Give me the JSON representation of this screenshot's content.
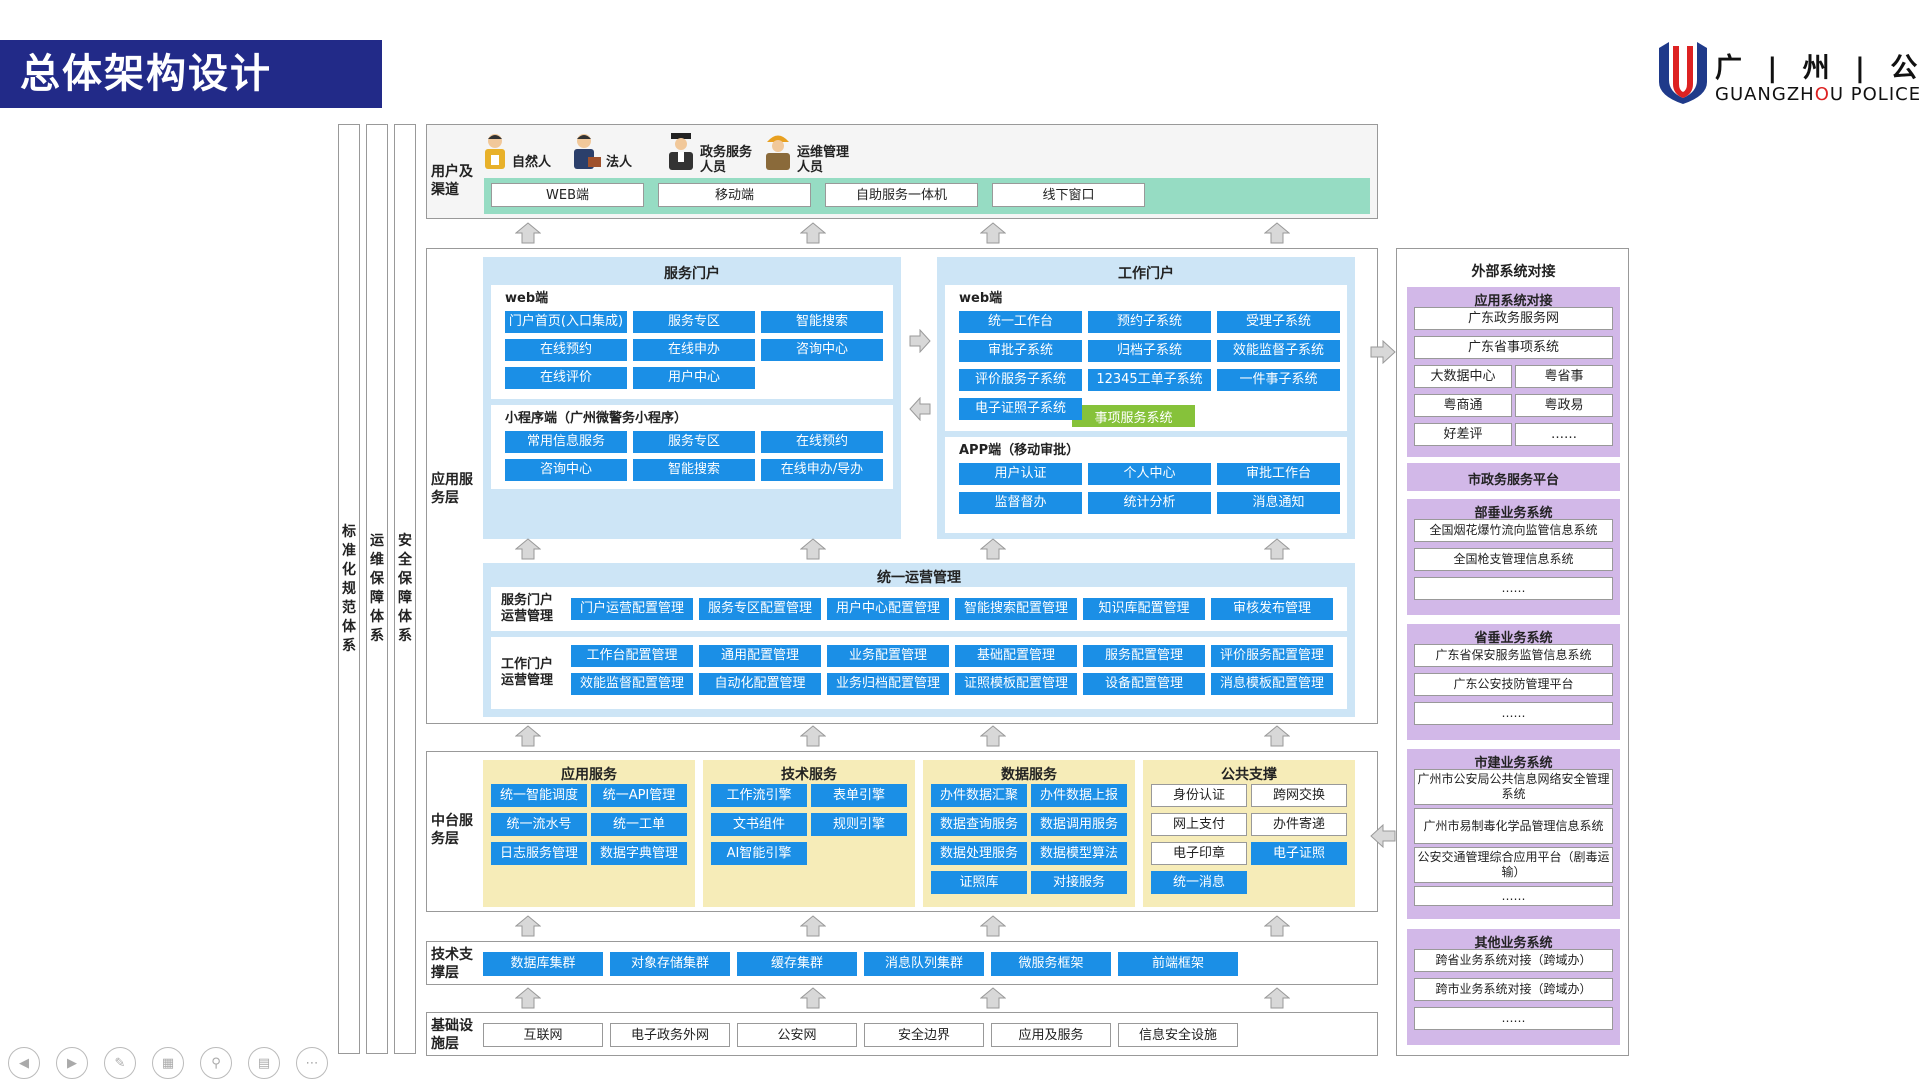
{
  "page": {
    "title": "总体架构设计"
  },
  "logo": {
    "cn": "广 | 州 | 公 | 安",
    "en_pre": "GUANGZH",
    "en_red": "O",
    "en_post": "U POLICE"
  },
  "side_columns": [
    "标准化规范体系",
    "运维保障体系",
    "安全保障体系"
  ],
  "user_layer": {
    "label": "用户及渠道",
    "users": [
      "自然人",
      "法人",
      "政务服务人员",
      "运维管理人员"
    ],
    "channels": [
      "WEB端",
      "移动端",
      "自助服务一体机",
      "线下窗口"
    ]
  },
  "app_layer": {
    "label": "应用服务层",
    "service_portal": {
      "title": "服务门户",
      "web_title": "web端",
      "web_items": [
        "门户首页(入口集成)",
        "服务专区",
        "智能搜索",
        "在线预约",
        "在线申办",
        "咨询中心",
        "在线评价",
        "用户中心"
      ],
      "mini_title": "小程序端（广州微警务小程序）",
      "mini_items": [
        "常用信息服务",
        "服务专区",
        "在线预约",
        "咨询中心",
        "智能搜索",
        "在线申办/导办"
      ]
    },
    "work_portal": {
      "title": "工作门户",
      "web_title": "web端",
      "web_items": [
        "统一工作台",
        "预约子系统",
        "受理子系统",
        "审批子系统",
        "归档子系统",
        "效能监督子系统",
        "评价服务子系统",
        "12345工单子系统",
        "一件事子系统",
        "电子证照子系统"
      ],
      "web_highlight": "事项服务系统",
      "app_title": "APP端（移动审批）",
      "app_items": [
        "用户认证",
        "个人中心",
        "审批工作台",
        "监督督办",
        "统计分析",
        "消息通知"
      ]
    },
    "ops": {
      "title": "统一运营管理",
      "row1_label": "服务门户运营管理",
      "row1": [
        "门户运营配置管理",
        "服务专区配置管理",
        "用户中心配置管理",
        "智能搜索配置管理",
        "知识库配置管理",
        "审核发布管理"
      ],
      "row2_label": "工作门户运营管理",
      "row2": [
        "工作台配置管理",
        "通用配置管理",
        "业务配置管理",
        "基础配置管理",
        "服务配置管理",
        "评价服务配置管理",
        "效能监督配置管理",
        "自动化配置管理",
        "业务归档配置管理",
        "证照模板配置管理",
        "设备配置管理",
        "消息模板配置管理"
      ]
    }
  },
  "middle_layer": {
    "label": "中台服务层",
    "groups": [
      {
        "title": "应用服务",
        "items": [
          "统一智能调度",
          "统一API管理",
          "统一流水号",
          "统一工单",
          "日志服务管理",
          "数据字典管理"
        ]
      },
      {
        "title": "技术服务",
        "items": [
          "工作流引擎",
          "表单引擎",
          "文书组件",
          "规则引擎",
          "AI智能引擎"
        ]
      },
      {
        "title": "数据服务",
        "items": [
          "办件数据汇聚",
          "办件数据上报",
          "数据查询服务",
          "数据调用服务",
          "数据处理服务",
          "数据模型算法",
          "证照库",
          "对接服务"
        ]
      },
      {
        "title": "公共支撑",
        "items": [
          "身份认证",
          "跨网交换",
          "网上支付",
          "办件寄递",
          "电子印章",
          "电子证照",
          "统一消息"
        ]
      }
    ]
  },
  "tech_layer": {
    "label": "技术支撑层",
    "items": [
      "数据库集群",
      "对象存储集群",
      "缓存集群",
      "消息队列集群",
      "微服务框架",
      "前端框架"
    ]
  },
  "infra_layer": {
    "label": "基础设施层",
    "items": [
      "互联网",
      "电子政务外网",
      "公安网",
      "安全边界",
      "应用及服务",
      "信息安全设施"
    ]
  },
  "external": {
    "title": "外部系统对接",
    "app_sys": {
      "title": "应用系统对接",
      "full": [
        "广东政务服务网",
        "广东省事项系统"
      ],
      "pairs": [
        "大数据中心",
        "粤省事",
        "粤商通",
        "粤政易",
        "好差评",
        "……"
      ]
    },
    "city_platform": "市政务服务平台",
    "ministry": {
      "title": "部垂业务系统",
      "items": [
        "全国烟花爆竹流向监管信息系统",
        "全国枪支管理信息系统",
        "……"
      ]
    },
    "province": {
      "title": "省垂业务系统",
      "items": [
        "广东省保安服务监管信息系统",
        "广东公安技防管理平台",
        "……"
      ]
    },
    "city": {
      "title": "市建业务系统",
      "items": [
        "广州市公安局公共信息网络安全管理系统",
        "广州市易制毒化学品管理信息系统",
        "公安交通管理综合应用平台（剧毒运输）",
        "……"
      ]
    },
    "other": {
      "title": "其他业务系统",
      "items": [
        "跨省业务系统对接（跨域办）",
        "跨市业务系统对接（跨域办）",
        "……"
      ]
    }
  },
  "colors": {
    "title_bg": "#222a88",
    "blue_box": "#1b8fe6",
    "panel": "#cde5f6",
    "yellow": "#f6ecb8",
    "purple": "#d2b8e8",
    "green": "#86c23a",
    "mint": "#96dcc3"
  }
}
